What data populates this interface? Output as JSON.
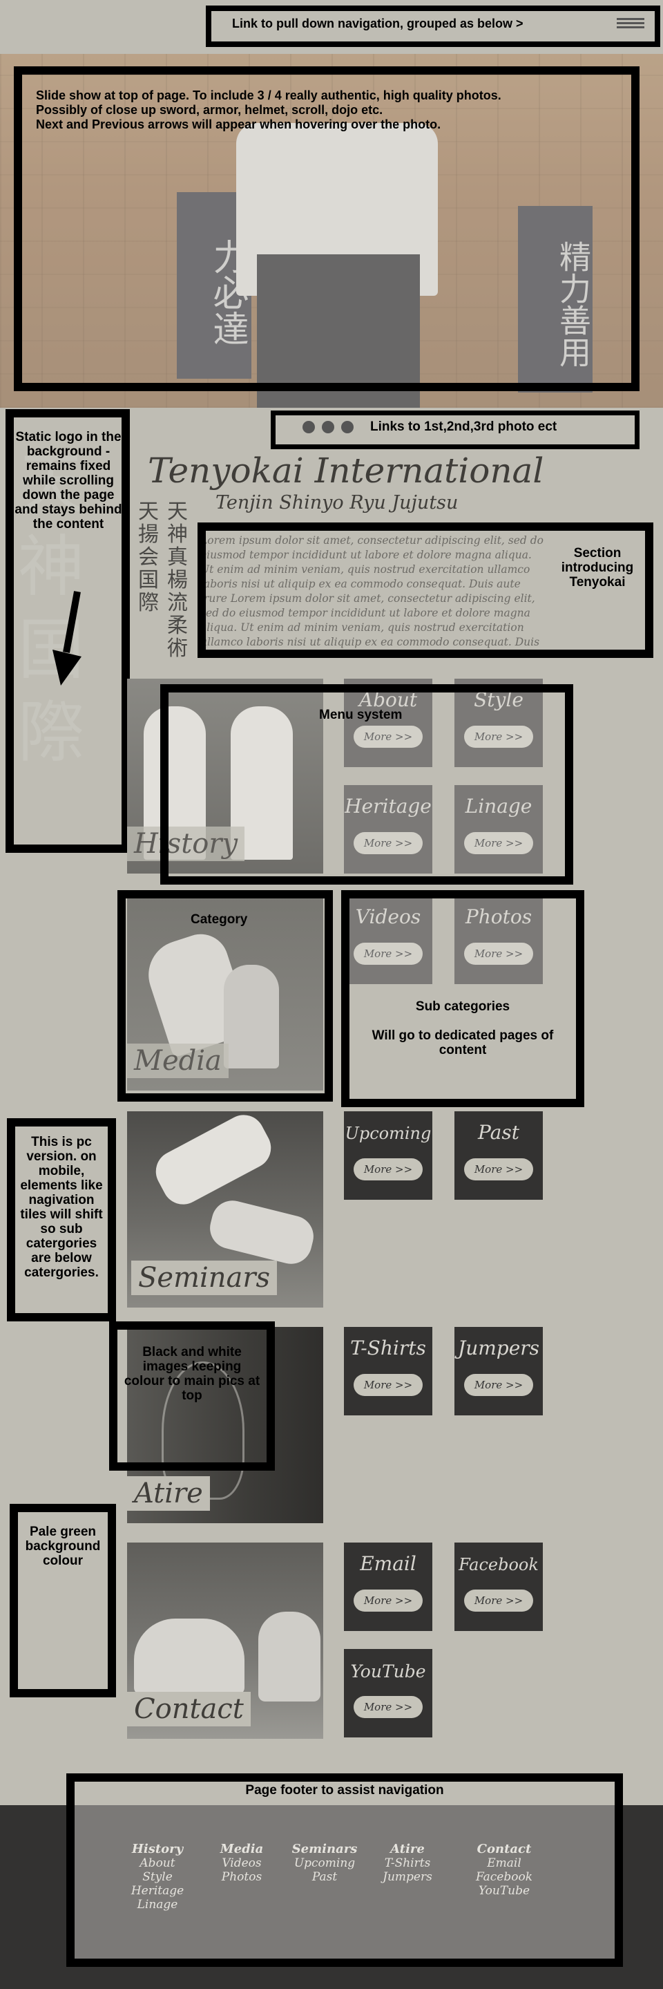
{
  "top_nav": {
    "text": "Link to pull down navigation, grouped as below >",
    "menu_icon": "hamburger-icon"
  },
  "slideshow": {
    "note_lines": [
      "Slide show at top of page. To include 3 / 4 really authentic, high quality photos.",
      "Possibly of close up sword, armor, helmet, scroll, dojo etc.",
      "Next and Previous arrows will appear when hovering over the photo."
    ],
    "banner_left": "力必達",
    "banner_right": "精力善用"
  },
  "slide_links": {
    "text": "Links to 1st,2nd,3rd photo ect"
  },
  "logo_note": "Static logo in the background - remains fixed while scrolling down the page and stays behind the content",
  "background_kanji": "天神国際",
  "header": {
    "title": "Tenyokai International",
    "subtitle": "Tenjin Shinyo Ryu Jujutsu",
    "kanji_col_1": "天揚会国際",
    "kanji_col_2": "天神真楊流柔術"
  },
  "intro": {
    "text": "Lorem ipsum dolor sit amet, consectetur adipiscing elit, sed do eiusmod tempor incididunt ut labore et dolore magna aliqua. Ut enim ad minim veniam, quis nostrud exercitation ullamco laboris nisi ut aliquip ex ea commodo consequat. Duis aute irure Lorem ipsum dolor sit amet, consectetur adipiscing elit, sed do eiusmod tempor incididunt ut labore et dolore magna aliqua. Ut enim ad minim veniam, quis nostrud exercitation ullamco laboris nisi ut aliquip ex ea commodo consequat. Duis aute irure",
    "note": "Section introducing Tenyokai"
  },
  "more_label": "More >>",
  "categories": [
    {
      "name": "History",
      "subs": [
        "About",
        "Style",
        "Heritage",
        "Linage"
      ],
      "tone": "grey"
    },
    {
      "name": "Media",
      "subs": [
        "Videos",
        "Photos"
      ],
      "tone": "grey"
    },
    {
      "name": "Seminars",
      "subs": [
        "Upcoming",
        "Past"
      ],
      "tone": "dark"
    },
    {
      "name": "Atire",
      "subs": [
        "T-Shirts",
        "Jumpers"
      ],
      "tone": "dark"
    },
    {
      "name": "Contact",
      "subs": [
        "Email",
        "Facebook",
        "YouTube"
      ],
      "tone": "dark"
    }
  ],
  "notes": {
    "menu_system": "Menu system",
    "category": "Category",
    "sub_categories": "Sub categories",
    "sub_categories_detail": "Will go to dedicated pages of content",
    "pc_version": "This is pc version. on mobile, elements like nagivation tiles will shift so sub catergories are below catergories.",
    "black_white": "Black and white images keeping colour to main pics at top",
    "pale_green": "Pale green background colour",
    "footer": "Page footer to assist navigation"
  },
  "footer": {
    "columns": [
      {
        "head": "History",
        "items": [
          "About",
          "Style",
          "Heritage",
          "Linage"
        ]
      },
      {
        "head": "Media",
        "items": [
          "Videos",
          "Photos"
        ]
      },
      {
        "head": "Seminars",
        "items": [
          "Upcoming",
          "Past"
        ]
      },
      {
        "head": "Atire",
        "items": [
          "T-Shirts",
          "Jumpers"
        ]
      },
      {
        "head": "Contact",
        "items": [
          "Email",
          "Facebook",
          "YouTube"
        ]
      }
    ]
  },
  "colors": {
    "page_bg": "#bfbdb4",
    "tile_grey": "#7b7977",
    "tile_dark": "#333231",
    "footer_bg": "#333231",
    "footer_panel": "#7b7977"
  }
}
